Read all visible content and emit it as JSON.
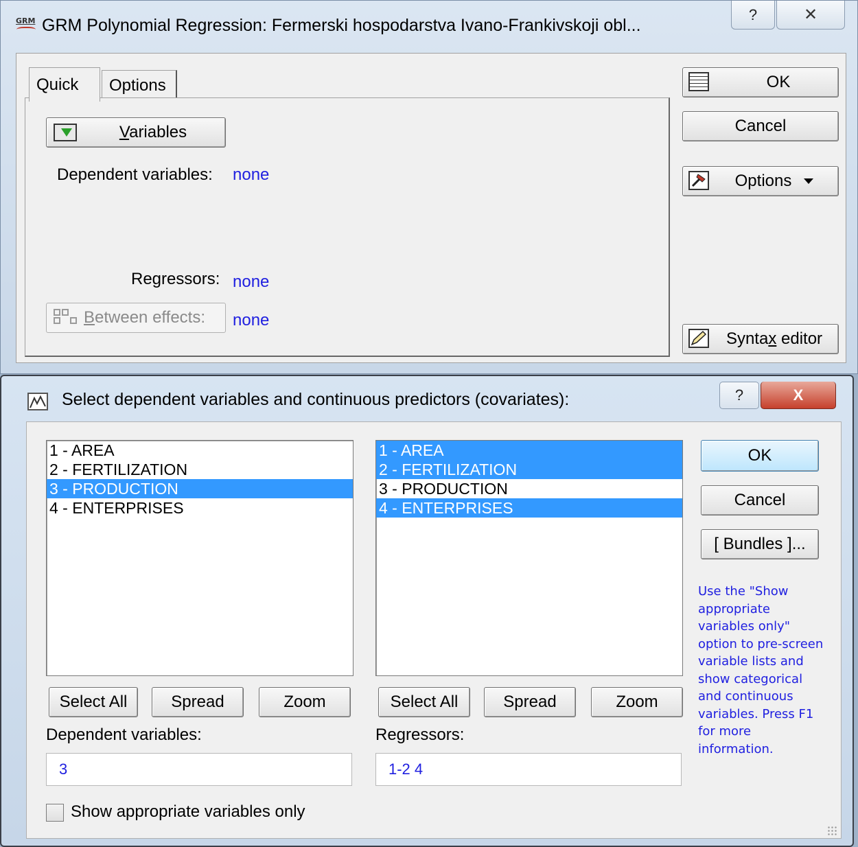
{
  "grm_window": {
    "title": "GRM Polynomial Regression: Fermerski hospodarstva Ivano-Frankivskoji obl...",
    "icon_text": "GRM",
    "help_button": "?",
    "close_button": "✕",
    "tabs": [
      {
        "label": "Quick",
        "active": true
      },
      {
        "label": "Options",
        "active": false
      }
    ],
    "variables_button": {
      "underlined": "V",
      "rest": "ariables"
    },
    "dependent_label": "Dependent variables:",
    "dependent_value": "none",
    "regressors_label": "Regressors:",
    "regressors_value": "none",
    "between_button": {
      "underlined": "B",
      "rest": "etween effects:"
    },
    "between_value": "none",
    "buttons": {
      "ok": "OK",
      "cancel": "Cancel",
      "options": "Options",
      "syntax_pre": "Synta",
      "syntax_underlined": "x",
      "syntax_post": " editor"
    }
  },
  "select_window": {
    "title": "Select dependent variables and continuous predictors (covariates):",
    "help_button": "?",
    "close_button": "X",
    "left_list": [
      {
        "label": "1 - AREA",
        "selected": false
      },
      {
        "label": "2 - FERTILIZATION",
        "selected": false
      },
      {
        "label": "3 - PRODUCTION",
        "selected": true
      },
      {
        "label": "4 - ENTERPRISES",
        "selected": false
      }
    ],
    "right_list": [
      {
        "label": "1 - AREA",
        "selected": true
      },
      {
        "label": "2 - FERTILIZATION",
        "selected": true
      },
      {
        "label": "3 - PRODUCTION",
        "selected": false
      },
      {
        "label": "4 - ENTERPRISES",
        "selected": true
      }
    ],
    "left_buttons": {
      "select_all": "Select All",
      "spread": "Spread",
      "zoom": "Zoom"
    },
    "right_buttons": {
      "select_all": "Select All",
      "spread": "Spread",
      "zoom": "Zoom"
    },
    "dependent_label": "Dependent variables:",
    "dependent_input": "3",
    "regressors_label": "Regressors:",
    "regressors_input": "1-2 4",
    "ok": "OK",
    "cancel": "Cancel",
    "bundles": "[ Bundles ]...",
    "help_text": "Use the \"Show appropriate variables only\" option to pre-screen variable lists and show categorical and continuous variables. Press F1 for more information.",
    "checkbox_label": "Show appropriate variables only",
    "checkbox_checked": false
  },
  "colors": {
    "value_blue": "#2020e0",
    "selection_blue": "#3399ff",
    "close_red": "#c6402c"
  }
}
